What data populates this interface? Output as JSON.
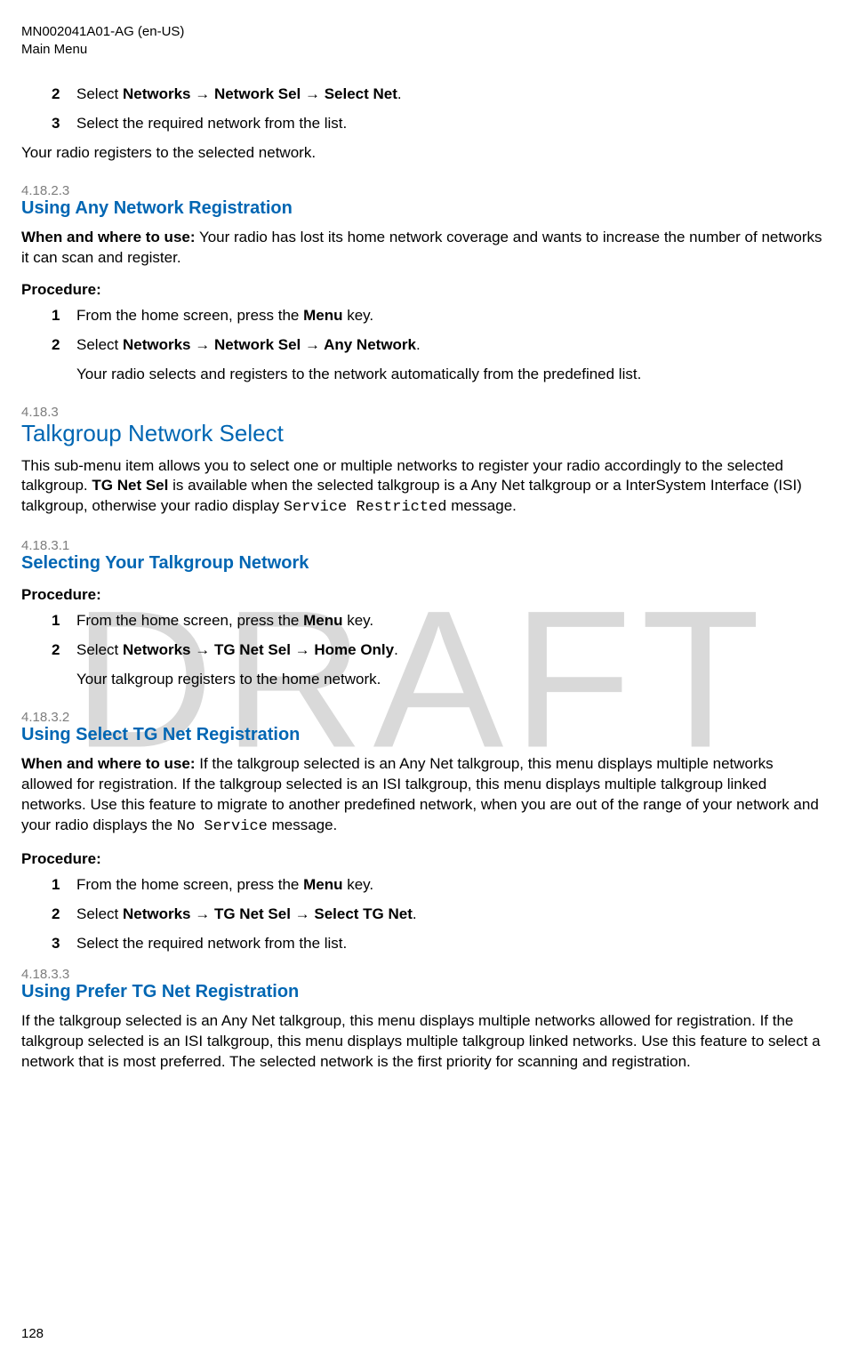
{
  "header": {
    "doc_id": "MN002041A01-AG (en-US)",
    "section": "Main Menu"
  },
  "watermark": "DRAFT",
  "page_number": "128",
  "intro_steps": [
    {
      "num": "2",
      "plain_prefix": "Select ",
      "bold": "Networks → Network Sel → Select Net",
      "plain_suffix": "."
    },
    {
      "num": "3",
      "plain_prefix": "Select the required network from the list.",
      "bold": "",
      "plain_suffix": ""
    }
  ],
  "intro_result": "Your radio registers to the selected network.",
  "s4_18_2_3": {
    "num": "4.18.2.3",
    "title": "Using Any Network Registration",
    "when_label": "When and where to use:",
    "when_text": " Your radio has lost its home network coverage and wants to increase the number of networks it can scan and register.",
    "proc_label": "Procedure:",
    "steps": [
      {
        "num": "1",
        "pre": "From the home screen, press the ",
        "bold": "Menu",
        "post": " key."
      },
      {
        "num": "2",
        "pre": "Select ",
        "bold": "Networks → Network Sel → Any Network",
        "post": "."
      }
    ],
    "result": "Your radio selects and registers to the network automatically from the predefined list."
  },
  "s4_18_3": {
    "num": "4.18.3",
    "title": "Talkgroup Network Select",
    "para_pre": "This sub-menu item allows you to select one or multiple networks to register your radio accordingly to the selected talkgroup. ",
    "para_bold": "TG Net Sel",
    "para_mid": " is available when the selected talkgroup is a Any Net talkgroup or a InterSystem Interface (ISI) talkgroup, otherwise your radio display ",
    "para_mono": "Service Restricted",
    "para_post": " message."
  },
  "s4_18_3_1": {
    "num": "4.18.3.1",
    "title": "Selecting Your Talkgroup Network",
    "proc_label": "Procedure:",
    "steps": [
      {
        "num": "1",
        "pre": "From the home screen, press the ",
        "bold": "Menu",
        "post": " key."
      },
      {
        "num": "2",
        "pre": "Select ",
        "bold": "Networks → TG Net Sel → Home Only",
        "post": "."
      }
    ],
    "result": "Your talkgroup registers to the home network."
  },
  "s4_18_3_2": {
    "num": "4.18.3.2",
    "title": "Using Select TG Net Registration",
    "when_label": "When and where to use:",
    "when_pre": " If the talkgroup selected is an Any Net talkgroup, this menu displays multiple networks allowed for registration. If the talkgroup selected is an ISI talkgroup, this menu displays multiple talkgroup linked networks. Use this feature to migrate to another predefined network, when you are out of the range of your network and your radio displays the ",
    "when_mono": "No Service",
    "when_post": " message.",
    "proc_label": "Procedure:",
    "steps": [
      {
        "num": "1",
        "pre": "From the home screen, press the ",
        "bold": "Menu",
        "post": " key."
      },
      {
        "num": "2",
        "pre": "Select ",
        "bold": "Networks → TG Net Sel → Select TG Net",
        "post": "."
      },
      {
        "num": "3",
        "pre": "Select the required network from the list.",
        "bold": "",
        "post": ""
      }
    ]
  },
  "s4_18_3_3": {
    "num": "4.18.3.3",
    "title": "Using Prefer TG Net Registration",
    "para": "If the talkgroup selected is an Any Net talkgroup, this menu displays multiple networks allowed for registration. If the talkgroup selected is an ISI talkgroup, this menu displays multiple talkgroup linked networks. Use this feature to select a network that is most preferred. The selected network is the first priority for scanning and registration."
  }
}
